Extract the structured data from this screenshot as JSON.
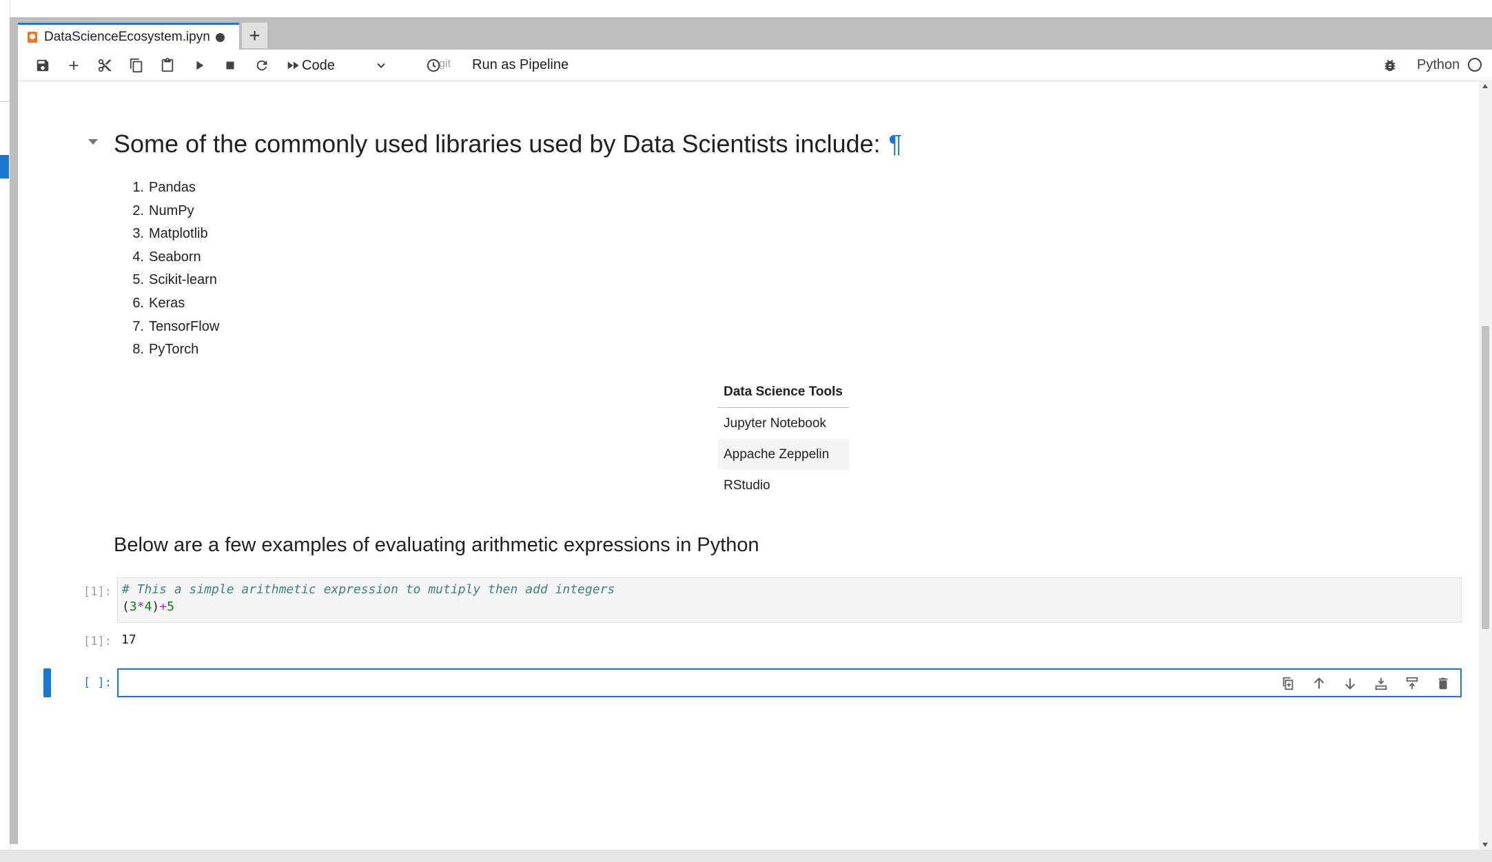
{
  "tab": {
    "title": "DataScienceEcosystem.ipyn",
    "new_tab_label": "+"
  },
  "toolbar": {
    "cell_type": "Code",
    "git_label": "git",
    "pipeline_label": "Run as Pipeline",
    "kernel_name": "Python",
    "icons": [
      "save-icon",
      "add-icon",
      "cut-icon",
      "copy-icon",
      "paste-icon",
      "run-icon",
      "stop-icon",
      "restart-icon",
      "fast-forward-icon",
      "clock-icon",
      "bug-icon"
    ]
  },
  "notebook": {
    "heading": "Some of the commonly used libraries used by Data Scientists include:",
    "anchor": "¶",
    "libraries": [
      {
        "num": "1.",
        "name": "Pandas"
      },
      {
        "num": "2.",
        "name": "NumPy"
      },
      {
        "num": "3.",
        "name": "Matplotlib"
      },
      {
        "num": "4.",
        "name": "Seaborn"
      },
      {
        "num": "5.",
        "name": "Scikit-learn"
      },
      {
        "num": "6.",
        "name": "Keras"
      },
      {
        "num": "7.",
        "name": "TensorFlow"
      },
      {
        "num": "8.",
        "name": "PyTorch"
      }
    ],
    "tools_table": {
      "header": "Data Science Tools",
      "rows": [
        "Jupyter Notebook",
        "Appache Zeppelin",
        "RStudio"
      ]
    },
    "subheading": "Below are a few examples of evaluating arithmetic expressions in Python",
    "code_cell": {
      "prompt": "[1]:",
      "comment": "# This a simple arithmetic expression to mutiply then add integers",
      "expr_parts": [
        "(",
        "3",
        "*",
        "4",
        ")",
        "+",
        "5"
      ]
    },
    "output": {
      "prompt": "[1]:",
      "value": "17"
    },
    "empty_cell": {
      "prompt": "[ ]:"
    }
  }
}
